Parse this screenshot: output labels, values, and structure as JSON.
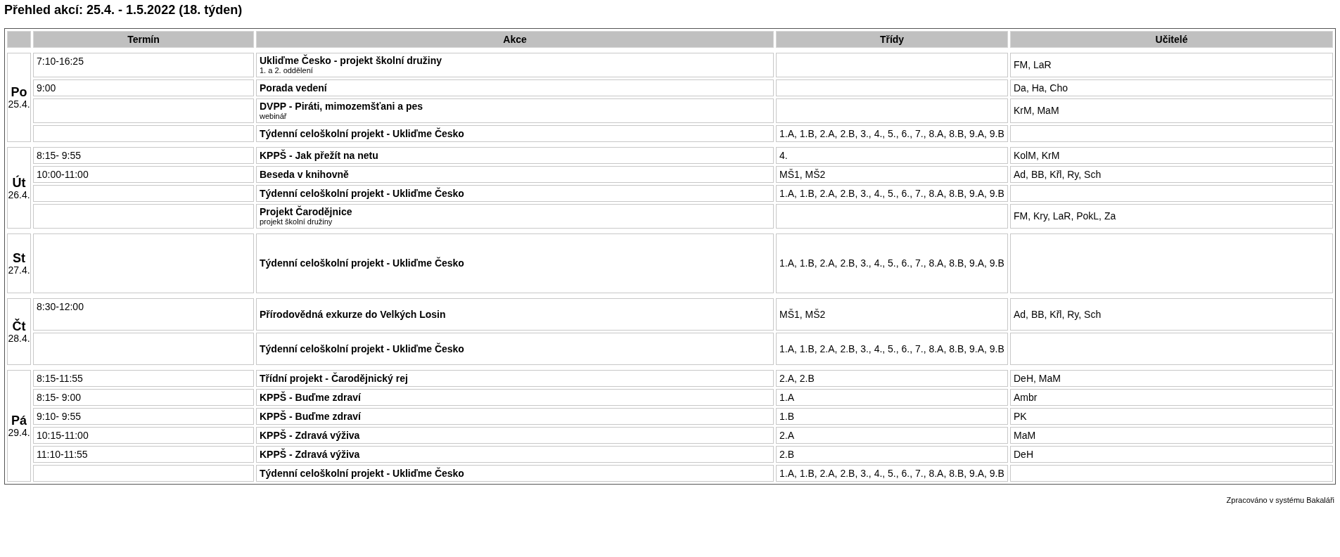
{
  "title": "Přehled akcí: 25.4. - 1.5.2022 (18. týden)",
  "columns": [
    "Termín",
    "Akce",
    "Třídy",
    "Učitelé"
  ],
  "days": [
    {
      "name": "Po",
      "date": "25.4.",
      "events": [
        {
          "time": "7:10-16:25",
          "title": "Ukliďme Česko - projekt školní družiny",
          "note": "1. a 2. oddělení",
          "teachers": "FM, LaR"
        },
        {
          "time": "9:00",
          "title": "Porada vedení",
          "teachers": "Da, Ha, Cho"
        },
        {
          "title": "DVPP - Piráti, mimozemšťani a pes",
          "note": "webinář",
          "teachers": "KrM, MaM"
        },
        {
          "title": "Týdenní celoškolní projekt - Ukliďme Česko",
          "classes": "1.A, 1.B, 2.A, 2.B, 3., 4., 5., 6., 7., 8.A, 8.B, 9.A, 9.B"
        }
      ]
    },
    {
      "name": "Út",
      "date": "26.4.",
      "events": [
        {
          "time": "8:15- 9:55",
          "title": "KPPŠ - Jak přežít na netu",
          "classes": "4.",
          "teachers": "KolM, KrM"
        },
        {
          "time": "10:00-11:00",
          "title": "Beseda v knihovně",
          "classes": "MŠ1, MŠ2",
          "teachers": "Ad, BB, Křl, Ry, Sch"
        },
        {
          "title": "Týdenní celoškolní projekt - Ukliďme Česko",
          "classes": "1.A, 1.B, 2.A, 2.B, 3., 4., 5., 6., 7., 8.A, 8.B, 9.A, 9.B"
        },
        {
          "title": "Projekt Čarodějnice",
          "note": "projekt školní družiny",
          "teachers": "FM, Kry, LaR, PokL, Za"
        }
      ]
    },
    {
      "name": "St",
      "date": "27.4.",
      "events": [
        {
          "title": "Týdenní celoškolní projekt - Ukliďme Česko",
          "classes": "1.A, 1.B, 2.A, 2.B, 3., 4., 5., 6., 7., 8.A, 8.B, 9.A, 9.B"
        }
      ]
    },
    {
      "name": "Čt",
      "date": "28.4.",
      "events": [
        {
          "time": "8:30-12:00",
          "title": "Přírodovědná exkurze do Velkých Losin",
          "classes": "MŠ1, MŠ2",
          "teachers": "Ad, BB, Křl, Ry, Sch"
        },
        {
          "title": "Týdenní celoškolní projekt - Ukliďme Česko",
          "classes": "1.A, 1.B, 2.A, 2.B, 3., 4., 5., 6., 7., 8.A, 8.B, 9.A, 9.B"
        }
      ]
    },
    {
      "name": "Pá",
      "date": "29.4.",
      "events": [
        {
          "time": "8:15-11:55",
          "title": "Třídní projekt - Čarodějnický rej",
          "classes": "2.A, 2.B",
          "teachers": "DeH, MaM"
        },
        {
          "time": "8:15- 9:00",
          "title": "KPPŠ - Buďme zdraví",
          "classes": "1.A",
          "teachers": "Ambr"
        },
        {
          "time": "9:10- 9:55",
          "title": "KPPŠ - Buďme zdraví",
          "classes": "1.B",
          "teachers": "PK"
        },
        {
          "time": "10:15-11:00",
          "title": "KPPŠ - Zdravá výživa",
          "classes": "2.A",
          "teachers": "MaM"
        },
        {
          "time": "11:10-11:55",
          "title": "KPPŠ - Zdravá výživa",
          "classes": "2.B",
          "teachers": "DeH"
        },
        {
          "title": "Týdenní celoškolní projekt - Ukliďme Česko",
          "classes": "1.A, 1.B, 2.A, 2.B, 3., 4., 5., 6., 7., 8.A, 8.B, 9.A, 9.B"
        }
      ]
    }
  ],
  "footer": "Zpracováno v systému Bakaláři"
}
